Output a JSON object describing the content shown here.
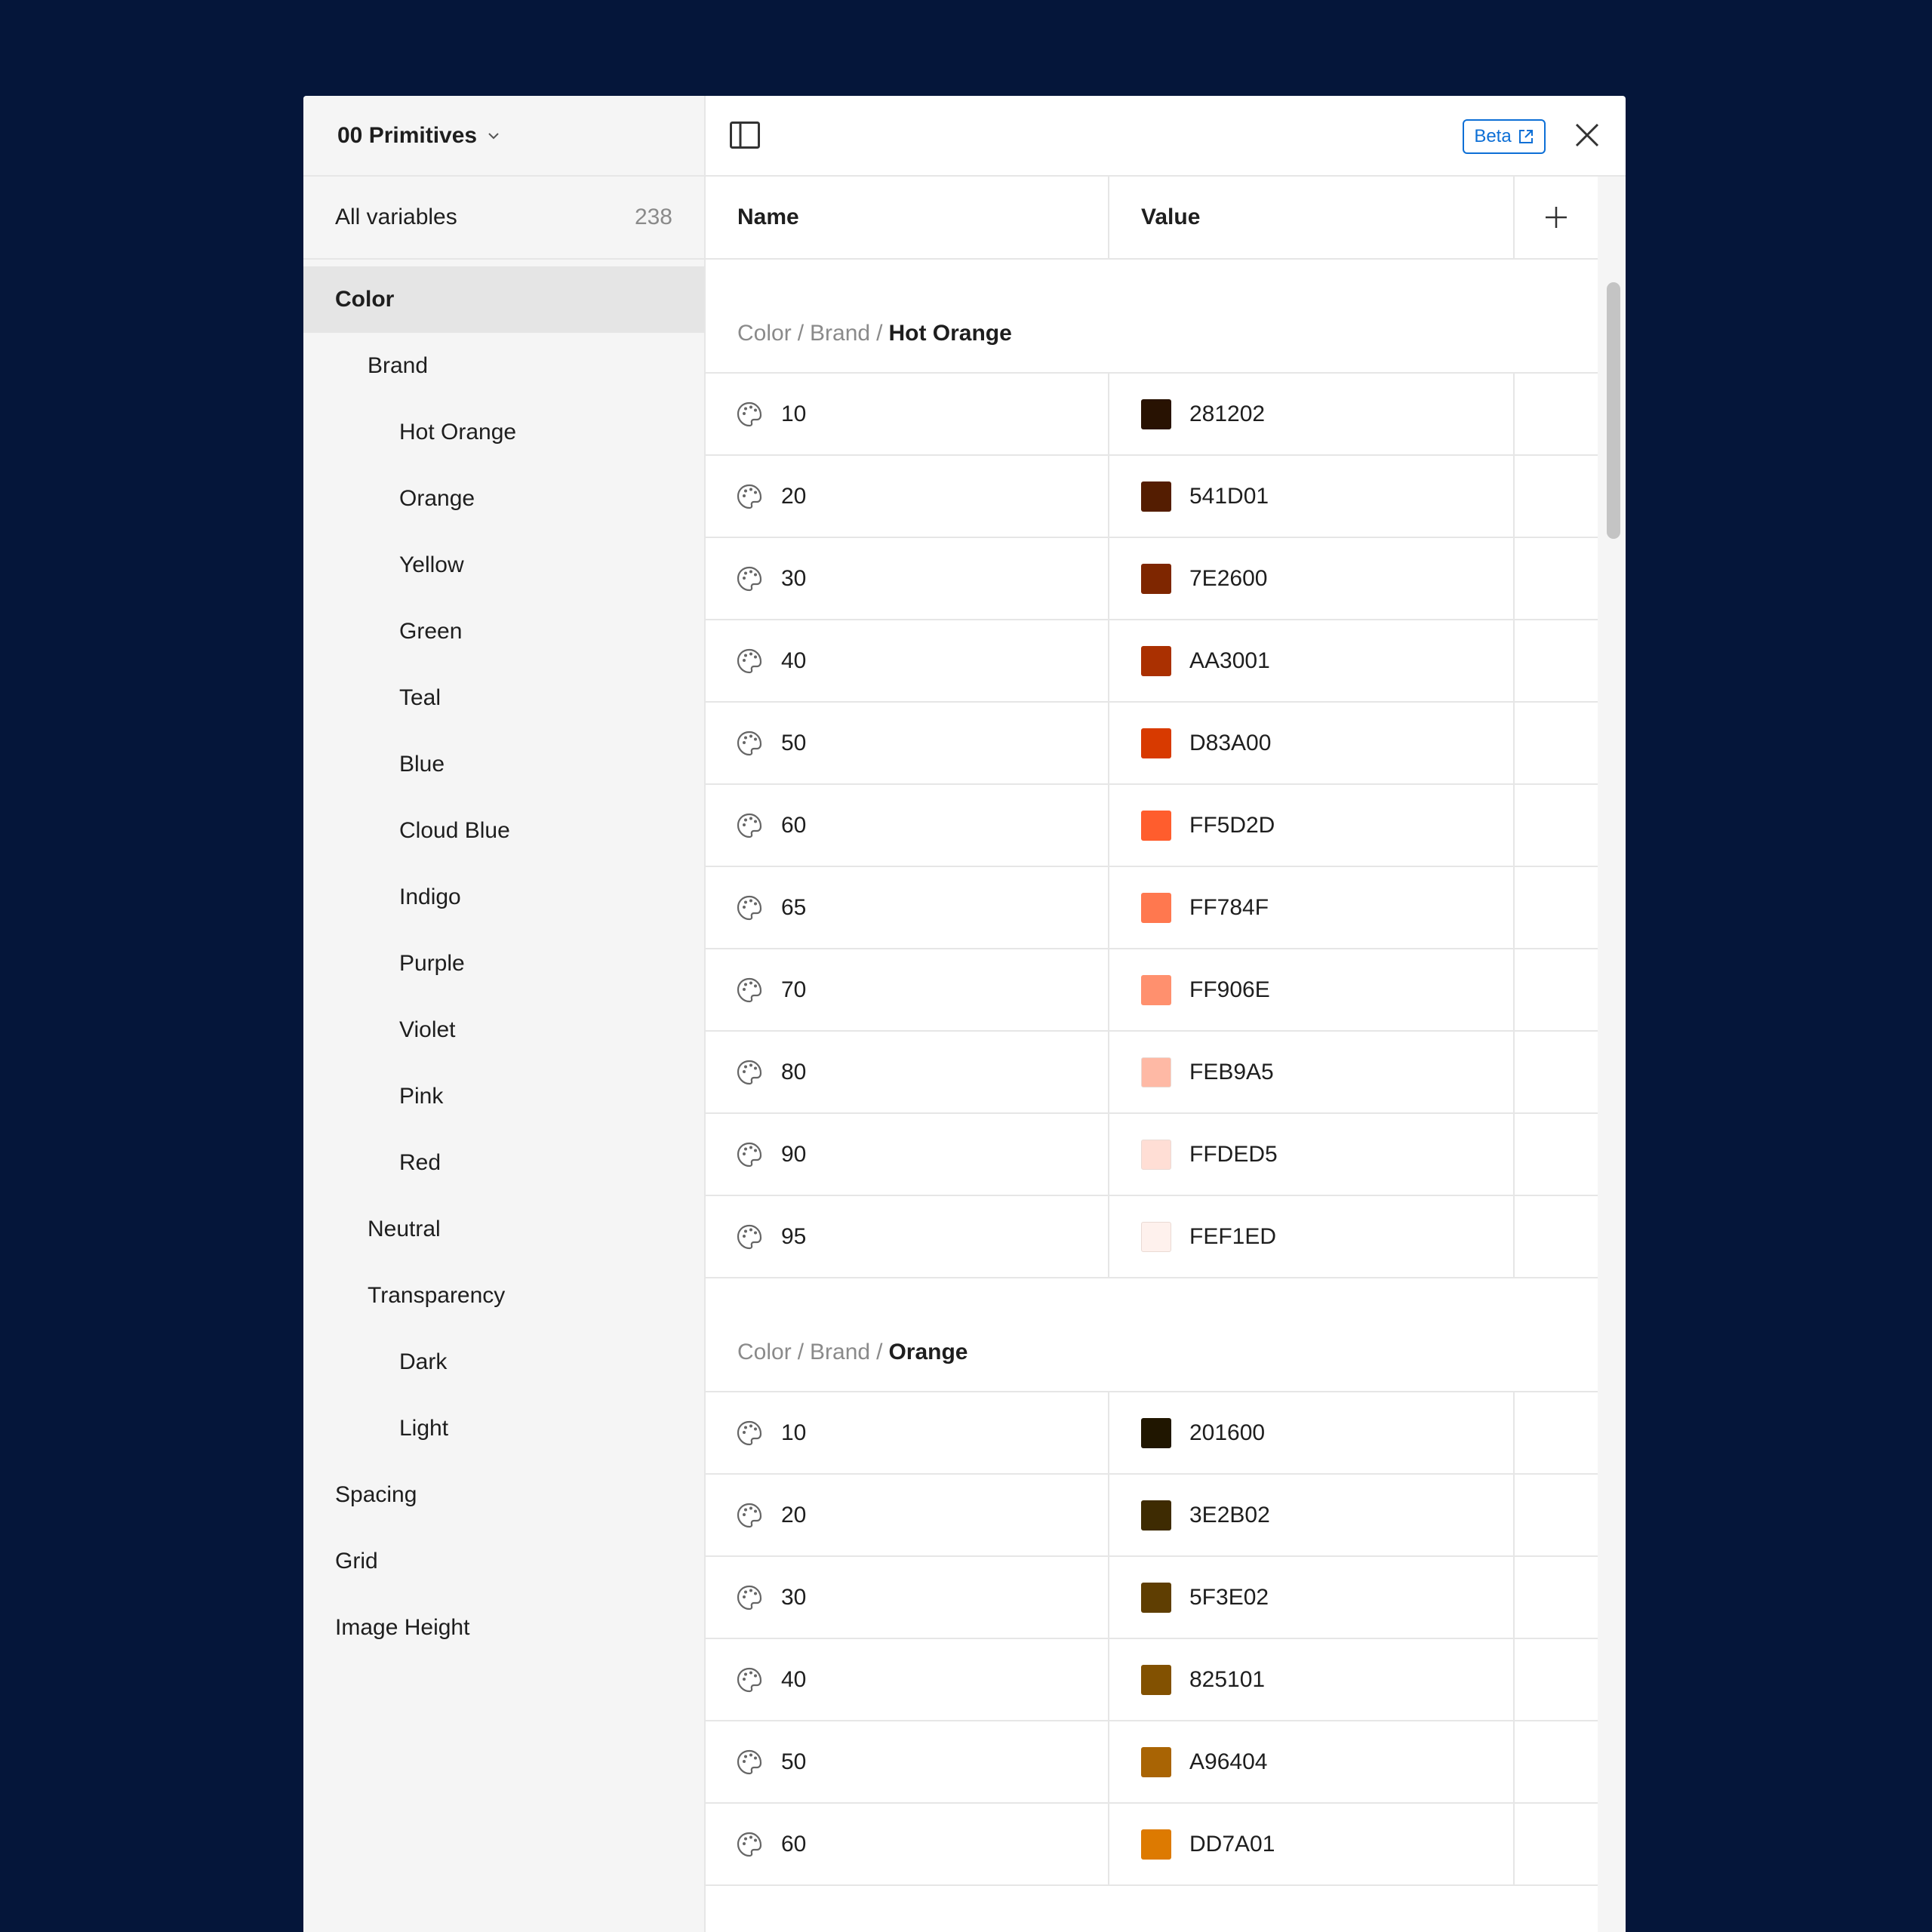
{
  "collection": {
    "name": "00 Primitives"
  },
  "all_variables": {
    "label": "All variables",
    "count": "238"
  },
  "tree": [
    {
      "label": "Color",
      "level": 0,
      "selected": true
    },
    {
      "label": "Brand",
      "level": 1
    },
    {
      "label": "Hot Orange",
      "level": 2
    },
    {
      "label": "Orange",
      "level": 2
    },
    {
      "label": "Yellow",
      "level": 2
    },
    {
      "label": "Green",
      "level": 2
    },
    {
      "label": "Teal",
      "level": 2
    },
    {
      "label": "Blue",
      "level": 2
    },
    {
      "label": "Cloud Blue",
      "level": 2
    },
    {
      "label": "Indigo",
      "level": 2
    },
    {
      "label": "Purple",
      "level": 2
    },
    {
      "label": "Violet",
      "level": 2
    },
    {
      "label": "Pink",
      "level": 2
    },
    {
      "label": "Red",
      "level": 2
    },
    {
      "label": "Neutral",
      "level": 1
    },
    {
      "label": "Transparency",
      "level": 1
    },
    {
      "label": "Dark",
      "level": 2
    },
    {
      "label": "Light",
      "level": 2
    },
    {
      "label": "Spacing",
      "level": 0
    },
    {
      "label": "Grid",
      "level": 0
    },
    {
      "label": "Image Height",
      "level": 0
    }
  ],
  "topbar": {
    "beta_label": "Beta"
  },
  "table": {
    "col_name": "Name",
    "col_value": "Value",
    "groups": [
      {
        "path": [
          "Color",
          "Brand"
        ],
        "leaf": "Hot Orange",
        "rows": [
          {
            "name": "10",
            "value": "281202",
            "color": "#281202"
          },
          {
            "name": "20",
            "value": "541D01",
            "color": "#541D01"
          },
          {
            "name": "30",
            "value": "7E2600",
            "color": "#7E2600"
          },
          {
            "name": "40",
            "value": "AA3001",
            "color": "#AA3001"
          },
          {
            "name": "50",
            "value": "D83A00",
            "color": "#D83A00"
          },
          {
            "name": "60",
            "value": "FF5D2D",
            "color": "#FF5D2D"
          },
          {
            "name": "65",
            "value": "FF784F",
            "color": "#FF784F"
          },
          {
            "name": "70",
            "value": "FF906E",
            "color": "#FF906E"
          },
          {
            "name": "80",
            "value": "FEB9A5",
            "color": "#FEB9A5"
          },
          {
            "name": "90",
            "value": "FFDED5",
            "color": "#FFDED5"
          },
          {
            "name": "95",
            "value": "FEF1ED",
            "color": "#FEF1ED"
          }
        ]
      },
      {
        "path": [
          "Color",
          "Brand"
        ],
        "leaf": "Orange",
        "rows": [
          {
            "name": "10",
            "value": "201600",
            "color": "#201600"
          },
          {
            "name": "20",
            "value": "3E2B02",
            "color": "#3E2B02"
          },
          {
            "name": "30",
            "value": "5F3E02",
            "color": "#5F3E02"
          },
          {
            "name": "40",
            "value": "825101",
            "color": "#825101"
          },
          {
            "name": "50",
            "value": "A96404",
            "color": "#A96404"
          },
          {
            "name": "60",
            "value": "DD7A01",
            "color": "#DD7A01"
          }
        ]
      }
    ]
  }
}
